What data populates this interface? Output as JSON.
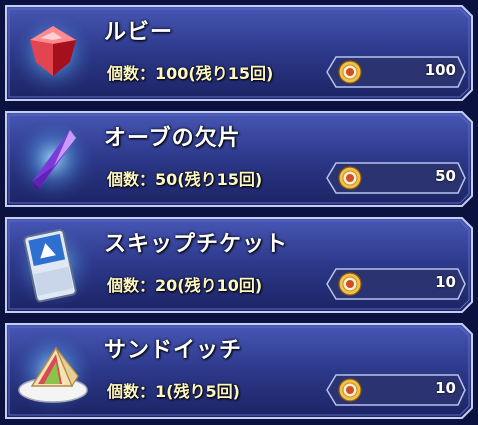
{
  "shop_items": [
    {
      "name": "ルビー",
      "count_text": "個数：100(残り15回)",
      "price": "100",
      "icon": "ruby-gem-icon"
    },
    {
      "name": "オーブの欠片",
      "count_text": "個数：50(残り15回)",
      "price": "50",
      "icon": "orb-shard-crystal-icon"
    },
    {
      "name": "スキップチケット",
      "count_text": "個数：20(残り10回)",
      "price": "10",
      "icon": "skip-ticket-icon"
    },
    {
      "name": "サンドイッチ",
      "count_text": "個数：1(残り5回)",
      "price": "10",
      "icon": "sandwich-icon"
    }
  ],
  "currency_icon": "gold-medal-coin-icon",
  "colors": {
    "panel_dark": "#1a2160",
    "panel_light": "#3a4aa8",
    "border": "#aab4e8",
    "count_text": "#fdf7c2",
    "price_pill": "#2b3470"
  }
}
